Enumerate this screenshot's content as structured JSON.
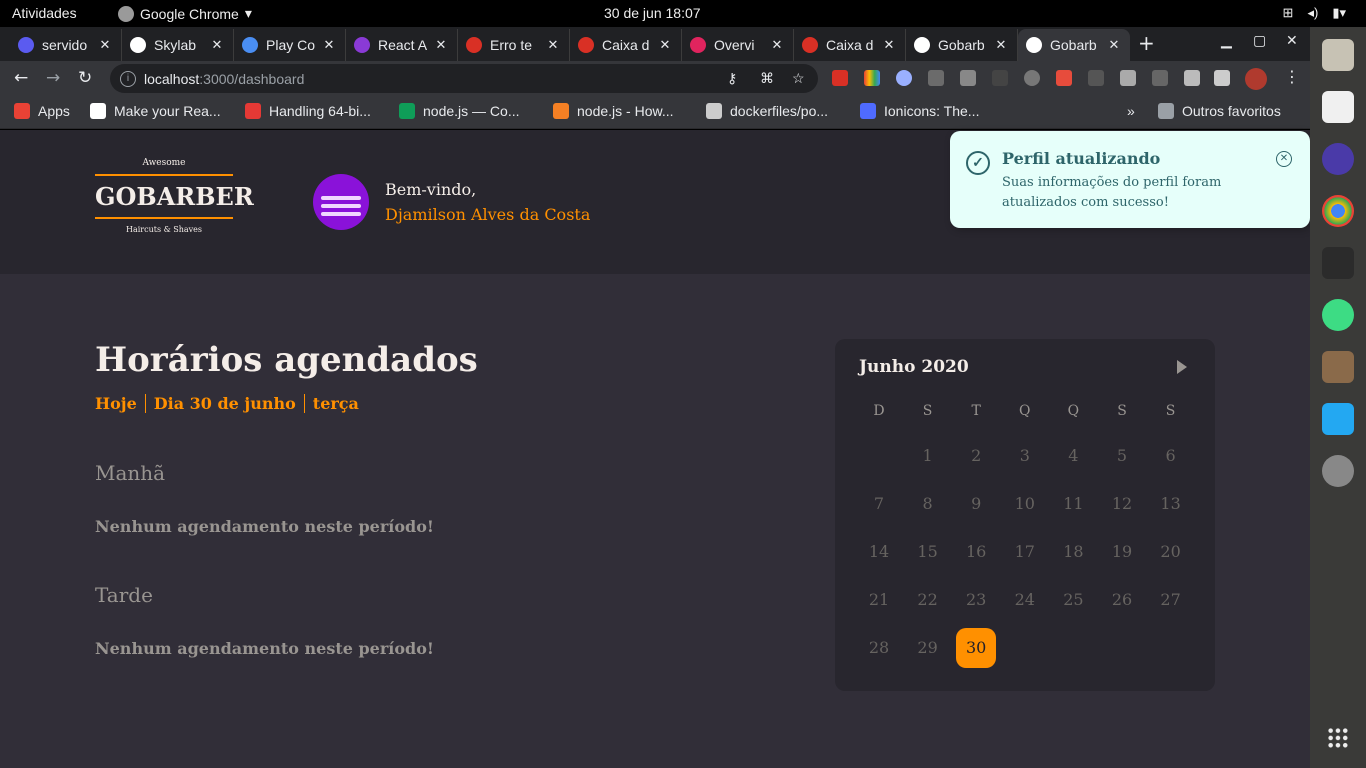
{
  "topbar": {
    "activities": "Atividades",
    "app_name": "Google Chrome",
    "clock": "30 de jun  18:07"
  },
  "tabs": [
    {
      "label": "servido",
      "color": "#5b5bf0"
    },
    {
      "label": "Skylab",
      "color": "#ffffff"
    },
    {
      "label": "Play Co",
      "color": "#4a8ef2"
    },
    {
      "label": "React A",
      "color": "#8a3ad6"
    },
    {
      "label": "Erro te",
      "color": "#d93025"
    },
    {
      "label": "Caixa d",
      "color": "#d93025"
    },
    {
      "label": "Overvi",
      "color": "#e0245e"
    },
    {
      "label": "Caixa d",
      "color": "#d93025"
    },
    {
      "label": "Gobarb",
      "color": "#ffffff"
    },
    {
      "label": "Gobarb",
      "color": "#ffffff"
    }
  ],
  "url": {
    "host": "localhost",
    "path": ":3000/dashboard"
  },
  "bookmarks": [
    {
      "label": "Apps",
      "color": "#e94235"
    },
    {
      "label": "Make your Rea...",
      "color": "#ffffff"
    },
    {
      "label": "Handling 64-bi...",
      "color": "#e53935"
    },
    {
      "label": "node.js — Co...",
      "color": "#0f9d58"
    },
    {
      "label": "node.js - How...",
      "color": "#f48024"
    },
    {
      "label": "dockerfiles/po...",
      "color": "#cccccc"
    },
    {
      "label": "Ionicons: The...",
      "color": "#4f6bff"
    }
  ],
  "bookmarks_other": "Outros favoritos",
  "app": {
    "logo_top": "Awesome",
    "logo_name": "GOBARBER",
    "logo_tag": "Haircuts & Shaves",
    "welcome": "Bem-vindo,",
    "user_name": "Djamilson Alves da Costa",
    "title": "Horários agendados",
    "today": "Hoje",
    "date": "Dia 30 de junho",
    "weekday": "terça",
    "morning_title": "Manhã",
    "morning_empty": "Nenhum agendamento neste período!",
    "afternoon_title": "Tarde",
    "afternoon_empty": "Nenhum agendamento neste período!"
  },
  "calendar": {
    "month": "Junho 2020",
    "weekdays": [
      "D",
      "S",
      "T",
      "Q",
      "Q",
      "S",
      "S"
    ],
    "first_weekday_index": 1,
    "days_in_month": 30,
    "selected": 30
  },
  "toast": {
    "title": "Perfil atualizando",
    "message": "Suas informações do perfil foram atualizados com sucesso!"
  },
  "colors": {
    "accent": "#ff9000",
    "background": "#312e38",
    "surface": "#28262e",
    "toast_bg": "#e6fffa",
    "toast_text": "#2e656a"
  }
}
